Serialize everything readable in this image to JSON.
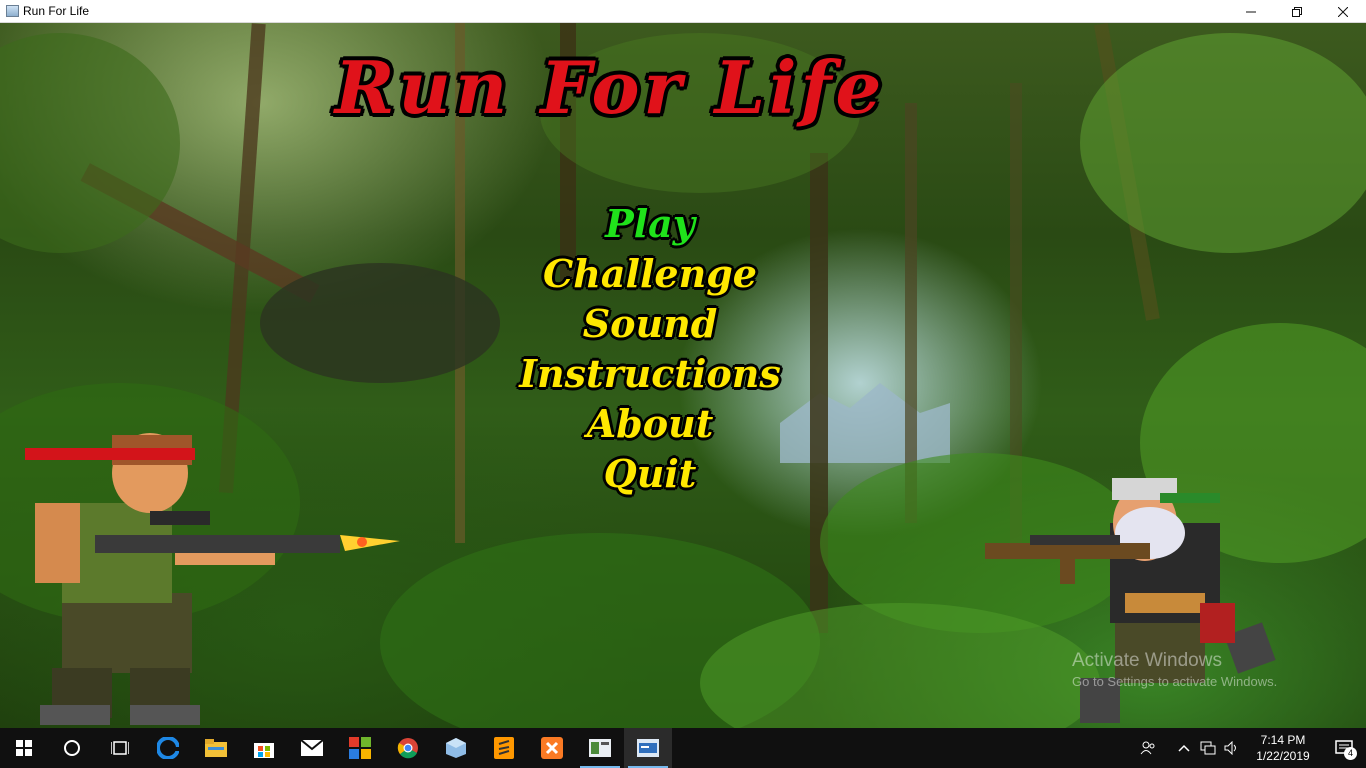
{
  "window": {
    "title": "Run For Life",
    "controls": [
      "minimize",
      "maximize",
      "close"
    ]
  },
  "game": {
    "title": "Run For Life",
    "menu": [
      {
        "label": "Play",
        "selected": true
      },
      {
        "label": "Challenge",
        "selected": false
      },
      {
        "label": "Sound",
        "selected": false
      },
      {
        "label": "Instructions",
        "selected": false
      },
      {
        "label": "About",
        "selected": false
      },
      {
        "label": "Quit",
        "selected": false
      }
    ],
    "colors": {
      "title": "#e0121a",
      "menu": "#ffe800",
      "menu_selected": "#20e21b"
    }
  },
  "watermark": {
    "line1": "Activate Windows",
    "line2": "Go to Settings to activate Windows."
  },
  "taskbar": {
    "apps": [
      "start-icon",
      "search-icon",
      "task-view-icon",
      "edge-icon",
      "file-explorer-icon",
      "store-icon",
      "mail-icon",
      "office-icon",
      "chrome-icon",
      "box-icon",
      "sublime-icon",
      "xampp-icon",
      "java-app-icon",
      "run-for-life-icon"
    ],
    "clock": {
      "time": "7:14 PM",
      "date": "1/22/2019"
    },
    "notification_count": "4"
  }
}
